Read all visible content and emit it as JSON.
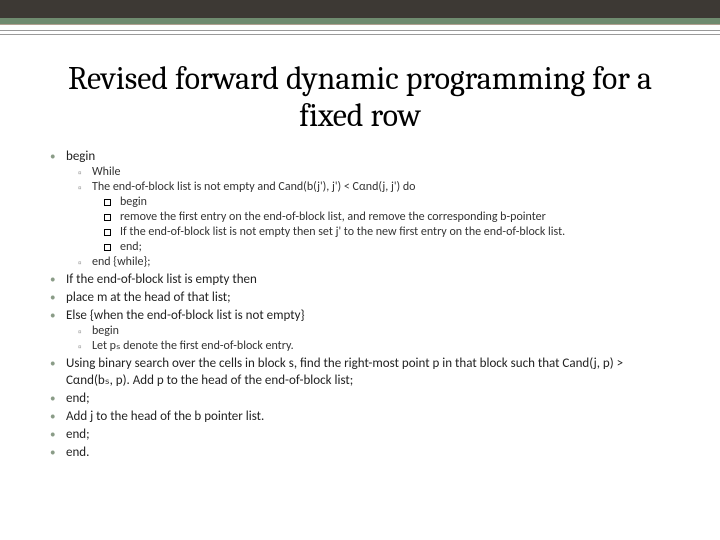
{
  "title": "Revised forward dynamic programming for a fixed row",
  "items": [
    {
      "text": "begin",
      "sub": [
        {
          "text": "While"
        },
        {
          "text": "The end-of-block list is not empty and Cand(b(j'), j') < Cαnd(j, j') do",
          "square": [
            "begin",
            "remove the first entry on the end-of-block list, and remove the corresponding b-pointer",
            "If the end-of-block list is not empty then set j' to the new first entry on the end-of-block list.",
            "end;"
          ]
        },
        {
          "text": "end {while};"
        }
      ]
    },
    {
      "text": "If the end-of-block list is empty then"
    },
    {
      "text": "place m at the head of that list;"
    },
    {
      "text": "Else {when the end-of-block list is not empty}",
      "sub": [
        {
          "text": "begin"
        },
        {
          "text": "Let pₛ denote the first end-of-block entry."
        }
      ]
    },
    {
      "text": "Using binary search over the cells in block s, find the right-most point p in that block such that Cand(j, p) > Cαnd(bₛ, p). Add p to the head of the end-of-block list;"
    },
    {
      "text": "end;"
    },
    {
      "text": "Add j to the head of the b pointer list."
    },
    {
      "text": "end;"
    },
    {
      "text": "end."
    }
  ]
}
